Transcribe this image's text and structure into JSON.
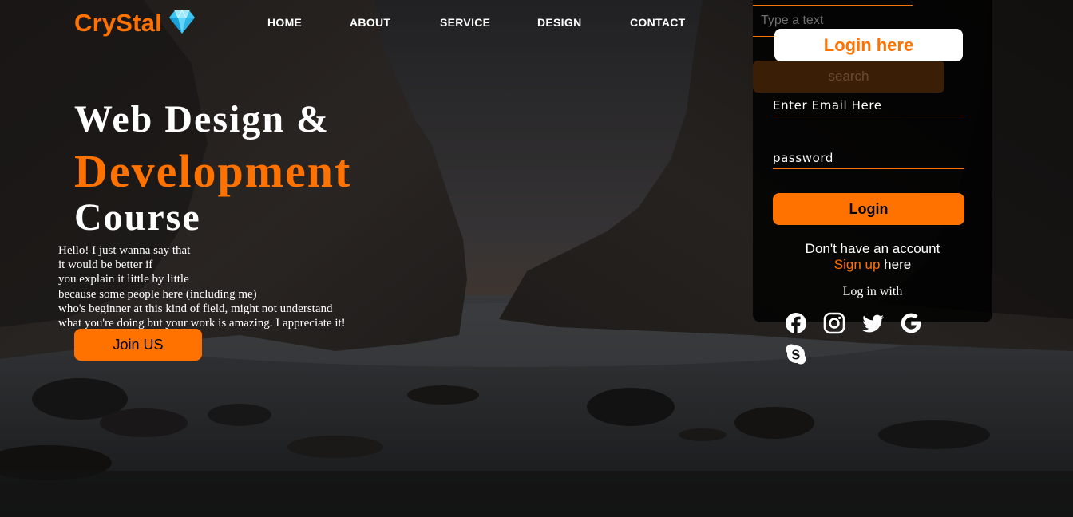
{
  "brand": {
    "name": "CryStal",
    "logo_icon": "diamond-icon",
    "accent_color": "#ff7200"
  },
  "nav": {
    "items": [
      {
        "label": "HOME"
      },
      {
        "label": "ABOUT"
      },
      {
        "label": "SERVICE"
      },
      {
        "label": "DESIGN"
      },
      {
        "label": "CONTACT"
      }
    ]
  },
  "search": {
    "placeholder": "Type a text",
    "button_label": "search"
  },
  "hero": {
    "title_line1": "Web Design &",
    "title_line2": "Development",
    "title_line3": "Course",
    "paragraph_lines": [
      "Hello! I just wanna say that",
      "it would be better if",
      "you explain it little by little",
      "because some people here (including me)",
      "who's beginner at this kind of field, might not understand",
      "what you're doing but your work is amazing. I appreciate it!"
    ],
    "cta_label": "Join US"
  },
  "login_form": {
    "heading": "Login here",
    "email_placeholder": "Enter Email Here",
    "password_placeholder": "password",
    "submit_label": "Login",
    "signup_prefix": "Don't have an account",
    "signup_link": "Sign up",
    "signup_suffix": " here",
    "login_with": "Log in with",
    "social_icons": [
      "facebook-icon",
      "instagram-icon",
      "twitter-icon",
      "google-icon",
      "skype-icon"
    ]
  }
}
